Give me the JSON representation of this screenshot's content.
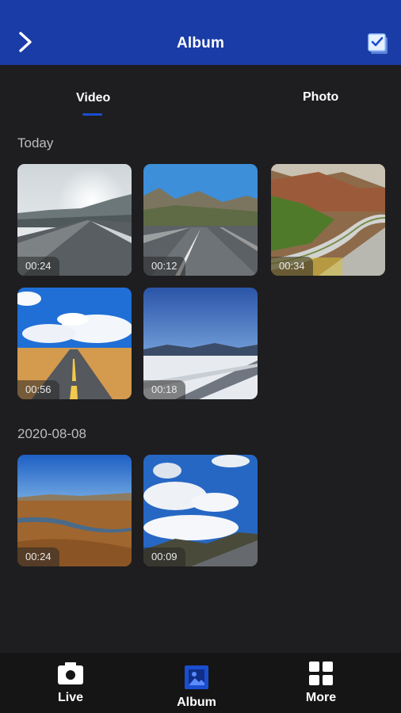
{
  "header": {
    "title": "Album",
    "back_icon": "chevron-right-icon",
    "select_icon": "select-checkbox-icon",
    "background": "#1a3ca6"
  },
  "tabs": [
    {
      "label": "Video",
      "selected": true
    },
    {
      "label": "Photo",
      "selected": false
    }
  ],
  "sections": [
    {
      "title": "Today",
      "items": [
        {
          "duration": "00:24",
          "scene": "cloudy-highway"
        },
        {
          "duration": "00:12",
          "scene": "mountain-highway"
        },
        {
          "duration": "00:34",
          "scene": "curved-road-hills"
        },
        {
          "duration": "00:56",
          "scene": "desert-road-blue-sky"
        },
        {
          "duration": "00:18",
          "scene": "snowy-road"
        }
      ]
    },
    {
      "title": "2020-08-08",
      "items": [
        {
          "duration": "00:24",
          "scene": "plateau-river"
        },
        {
          "duration": "00:09",
          "scene": "clouds-hills"
        }
      ]
    }
  ],
  "bottom_nav": [
    {
      "label": "Live",
      "icon": "camera-icon",
      "selected": false
    },
    {
      "label": "Album",
      "icon": "album-icon",
      "selected": true
    },
    {
      "label": "More",
      "icon": "grid-icon",
      "selected": false
    }
  ],
  "colors": {
    "accent": "#1a4ed0",
    "background": "#1e1e20",
    "bottom_bar": "#151516"
  }
}
